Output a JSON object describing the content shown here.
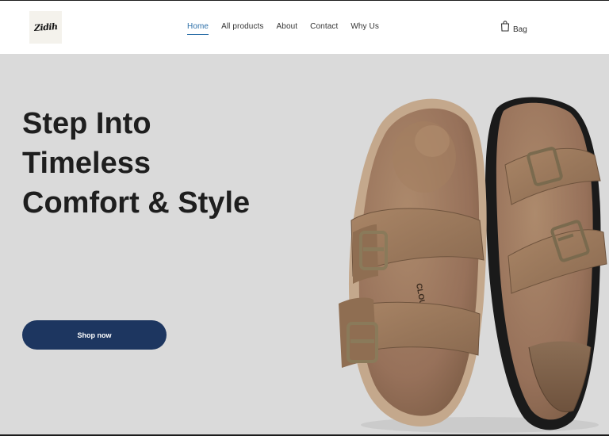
{
  "brand": {
    "logo_text": "Zidih"
  },
  "nav": {
    "items": [
      {
        "label": "Home",
        "active": true
      },
      {
        "label": "All products",
        "active": false
      },
      {
        "label": "About",
        "active": false
      },
      {
        "label": "Contact",
        "active": false
      },
      {
        "label": "Why Us",
        "active": false
      }
    ]
  },
  "cart": {
    "label": "Bag",
    "icon": "shopping-bag-icon"
  },
  "hero": {
    "title_lines": [
      "Step Into",
      "Timeless",
      "Comfort & Style"
    ],
    "cta_label": "Shop now",
    "image_alt": "Pair of brown suede two-strap sandals with cork footbed",
    "strap_text": "CLOUD"
  },
  "colors": {
    "accent": "#2c6fa8",
    "button": "#1d3660",
    "hero_bg": "#dadada",
    "sandal": "#9b7657"
  }
}
